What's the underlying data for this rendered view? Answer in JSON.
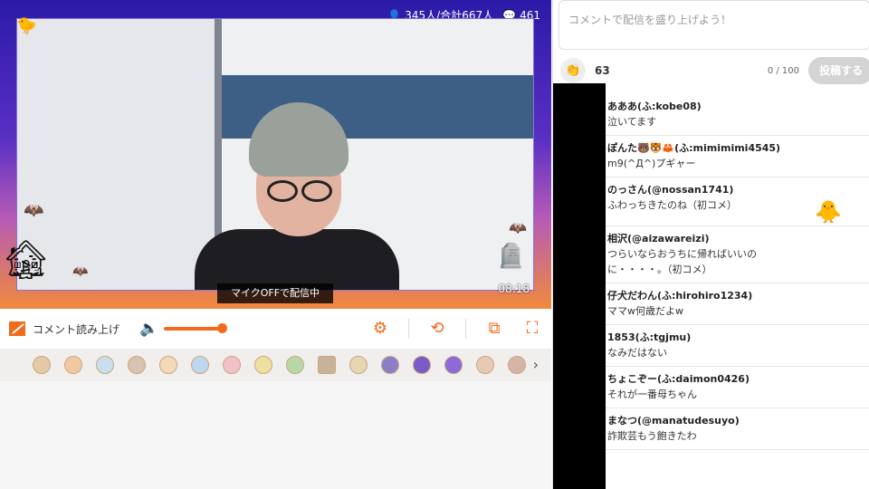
{
  "player": {
    "viewers": "345人/合計667人",
    "comments_count": "461",
    "mic_banner": "マイクOFFで配信中",
    "time": "08:18"
  },
  "controls": {
    "read_aloud_label": "コメント読み上げ",
    "volume_level": 1.0
  },
  "gift_row": {
    "count": 15
  },
  "comment_panel": {
    "input_placeholder": "コメントで配信を盛り上げよう！",
    "clap_count": "63",
    "char_count": "0 / 100",
    "post_label": "投稿する"
  },
  "comments": [
    {
      "name": "あああ(ふ:kobe08)",
      "text": "泣いてます"
    },
    {
      "name": "ぽんた🐻🐯🦀(ふ:mimimimi4545)",
      "text": "m9(^Д^)プギャー"
    },
    {
      "name": "のっさん(@nossan1741)",
      "text": "ふわっちきたのね（初コメ）"
    },
    {
      "name": "相沢(@aizawareizi)",
      "text": "つらいならおうちに帰ればいいのに・・・・。（初コメ）"
    },
    {
      "name": "仔犬だわん(ふ:hirohiro1234)",
      "text": "ママw何歳だよw"
    },
    {
      "name": "1853(ふ:tgjmu)",
      "text": "なみだはない"
    },
    {
      "name": "ちょこぞー(ふ:daimon0426)",
      "text": "それが一番母ちゃん"
    },
    {
      "name": "まなつ(@manatudesuyo)",
      "text": "詐欺芸もう飽きたわ"
    }
  ],
  "colors": {
    "accent": "#f26a1b",
    "frame_top": "#2b1aa8",
    "frame_bottom": "#f08a3c"
  }
}
